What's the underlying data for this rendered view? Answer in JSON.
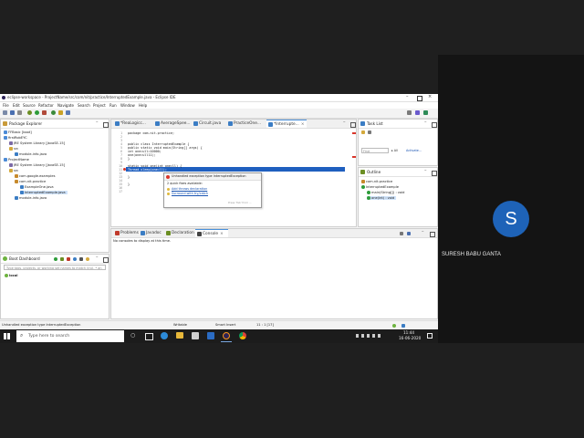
{
  "window": {
    "title": "eclipse-workspace - ProjectName/src/com/nit/practice/InterruptedExample.java - Eclipse IDE"
  },
  "menu": [
    "File",
    "Edit",
    "Source",
    "Refactor",
    "Navigate",
    "Search",
    "Project",
    "Run",
    "Window",
    "Help"
  ],
  "package_explorer": {
    "title": "Package Explorer",
    "items": [
      {
        "label": "FFBasic [boot]",
        "indent": 0
      },
      {
        "label": "firstRobEYC",
        "indent": 0
      },
      {
        "label": "JRE System Library [JavaSE-15]",
        "indent": 1
      },
      {
        "label": "src",
        "indent": 1
      },
      {
        "label": "module-info.java",
        "indent": 2
      },
      {
        "label": "ProjectName",
        "indent": 0
      },
      {
        "label": "JRE System Library [JavaSE-15]",
        "indent": 1
      },
      {
        "label": "src",
        "indent": 1
      },
      {
        "label": "com.google.examples",
        "indent": 2
      },
      {
        "label": "com.nit.practice",
        "indent": 2
      },
      {
        "label": "ExampleOne.java",
        "indent": 3
      },
      {
        "label": "InterruptedExample.java",
        "indent": 3
      },
      {
        "label": "module-info.java",
        "indent": 2
      }
    ]
  },
  "editor": {
    "tabs": [
      "*ReaLogicc...",
      "AverageSpee...",
      "Circuit.java",
      "PracticeOne...",
      "*Interrupte..."
    ],
    "line_numbers": [
      "1",
      "2",
      "3",
      "4",
      "5",
      "6",
      "7",
      "8",
      "9",
      "10",
      "11",
      "12",
      "13",
      "14",
      "15",
      "16",
      "17"
    ],
    "lines": [
      "package com.nit.practice;",
      "",
      "public class InterruptedExample {",
      "public static void main(String[] args) {",
      "    int one=ull=10000;",
      "    one(one=ull11);",
      "}",
      "",
      "static void one(int one=ll) {",
      "",
      "    Thread.sleep(one=ll);",
      "}",
      "",
      "}"
    ],
    "quickfix": {
      "header": "Unhandled exception type InterruptedException",
      "subheader": "2 quick fixes available:",
      "fixes": [
        "Add throws declaration",
        "Surround with try/catch"
      ],
      "footer": "Press 'Tab' from ..."
    }
  },
  "task_list": {
    "title": "Task List",
    "find_placeholder": "Find",
    "all_label": "All",
    "activate_label": "Activate..."
  },
  "outline": {
    "title": "Outline",
    "items": [
      {
        "label": "com.nit.practice",
        "indent": 0
      },
      {
        "label": "InterruptedExample",
        "indent": 0
      },
      {
        "label": "main(String[]) : void",
        "indent": 1
      },
      {
        "label": "one(int) : void",
        "indent": 1
      }
    ]
  },
  "bottom_panel": {
    "tabs": [
      "Problems",
      "Javadoc",
      "Declaration",
      "Console"
    ],
    "active_tab": "Console",
    "message": "No consoles to display at this time."
  },
  "boot_dashboard": {
    "title": "Boot Dashboard",
    "search_placeholder": "Type tags, projects, or working set names to match (incl. * an",
    "item": "local"
  },
  "status_bar": {
    "message": "Unhandled exception type InterruptedException",
    "writable": "Writable",
    "insert_mode": "Smart Insert",
    "position": "11 : 1 [17]"
  },
  "taskbar": {
    "search_placeholder": "Type here to search",
    "time": "11:44",
    "date": "16-06-2020"
  },
  "participant": {
    "initial": "S",
    "name": "SURESH BABU GANTA"
  },
  "colors": {
    "accent": "#1976d2",
    "avatar": "#1565c0",
    "taskbar": "#1c1c1c",
    "selection": "#3875d7"
  }
}
